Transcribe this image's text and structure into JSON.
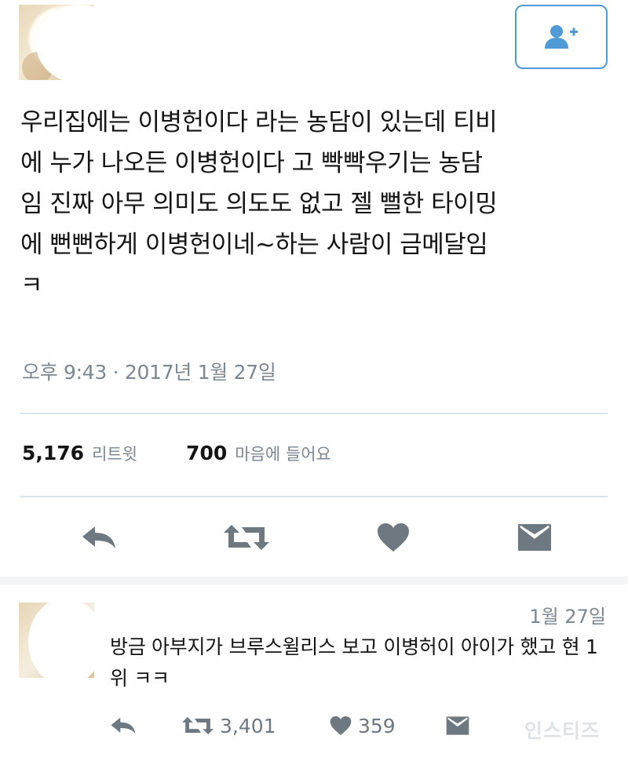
{
  "tweet": {
    "text": "우리집에는 이병헌이다 라는 농담이 있는데 티비\n에 누가 나오든 이병헌이다 고 빡빡우기는 농담\n임 진짜 아무 의미도 의도도 없고 젤 뻘한 타이밍\n에 뻔뻔하게 이병헌이네~하는 사람이 금메달임\nㅋ",
    "timestamp": "오후 9:43 · 2017년 1월 27일",
    "retweets_count": "5,176",
    "retweets_label": "리트윗",
    "likes_count": "700",
    "likes_label": "마음에 들어요"
  },
  "actions": {
    "reply_icon": "reply-icon",
    "retweet_icon": "retweet-icon",
    "like_icon": "heart-icon",
    "message_icon": "envelope-icon"
  },
  "follow_button_icon": "add-user-icon",
  "reply": {
    "date": "1월 27일",
    "text": "방금 아부지가 브루스윌리스 보고 이병허이 아이가 했고 현 1위 ㅋㅋ",
    "retweets_count": "3,401",
    "likes_count": "359"
  },
  "watermark": "인스티즈",
  "colors": {
    "accent": "#4f9ad6",
    "icon_gray": "#6d7881",
    "muted_text": "#7b8791",
    "divider": "#dbe4ea"
  }
}
